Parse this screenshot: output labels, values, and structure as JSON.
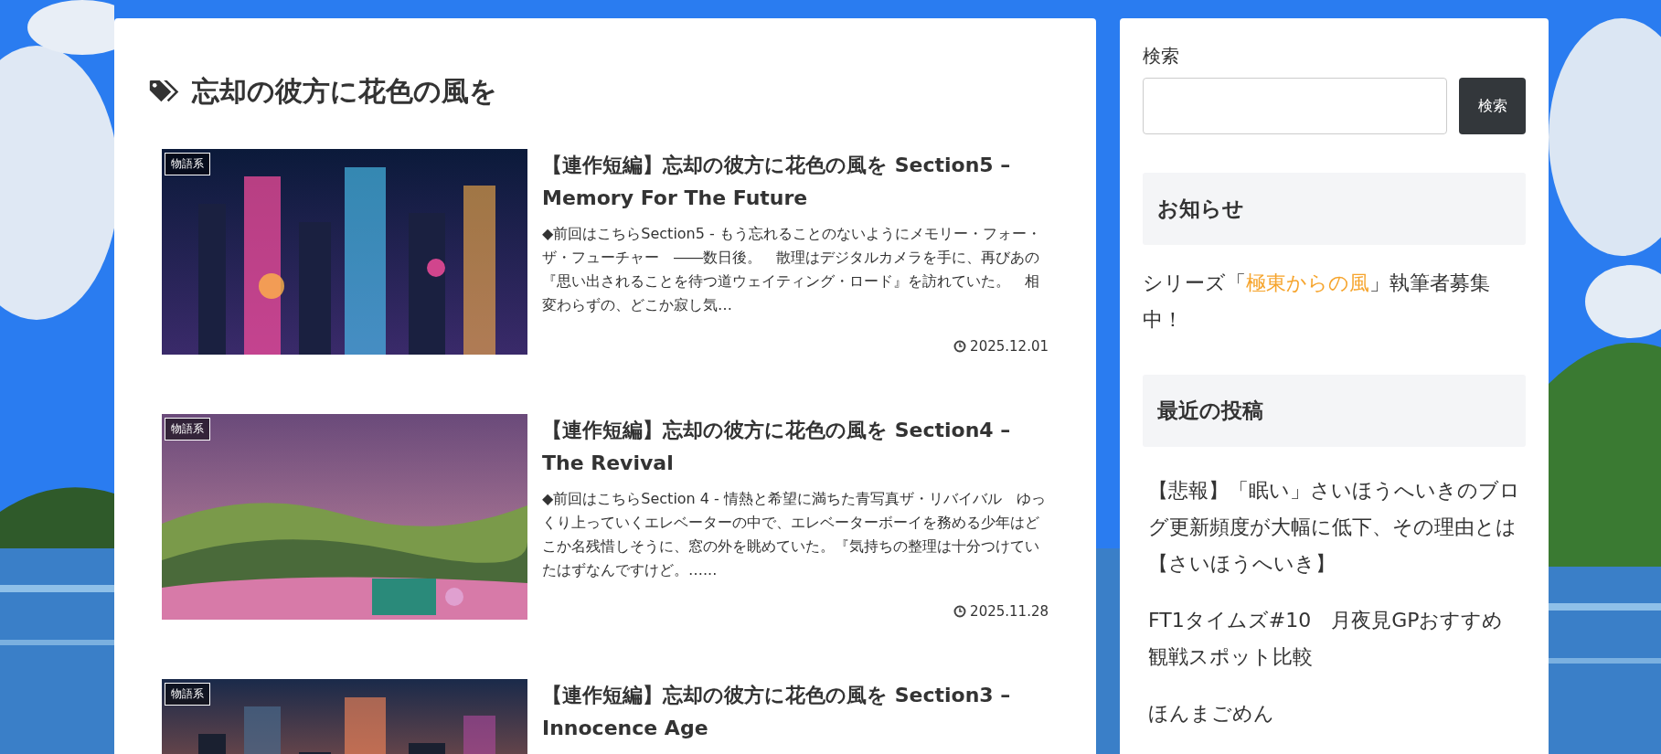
{
  "tag_archive": {
    "title": "忘却の彼方に花色の風を"
  },
  "posts": [
    {
      "category": "物語系",
      "title": "【連作短編】忘却の彼方に花色の風を Section5 – Memory For The Future",
      "excerpt": "◆前回はこちらSection5 - もう忘れることのないようにメモリー・フォー・ザ・フューチャー　――数日後。　散理はデジタルカメラを手に、再びあの『思い出されることを待つ道ウェイティング・ロード』を訪れていた。　相変わらずの、どこか寂し気…",
      "date": "2025.12.01"
    },
    {
      "category": "物語系",
      "title": "【連作短編】忘却の彼方に花色の風を Section4 – The Revival",
      "excerpt": "◆前回はこちらSection 4 - 情熱と希望に満ちた青写真ザ・リバイバル　ゆっくり上っていくエレベーターの中で、エレベーターボーイを務める少年はどこか名残惜しそうに、窓の外を眺めていた。『気持ちの整理は十分つけていたはずなんですけど。…...",
      "date": "2025.11.28"
    },
    {
      "category": "物語系",
      "title": "【連作短編】忘却の彼方に花色の風を Section3 – Innocence Age"
    }
  ],
  "sidebar": {
    "search": {
      "label": "検索",
      "button": "検索"
    },
    "notice": {
      "heading": "お知らせ",
      "text_before": "シリーズ「",
      "link": "極東からの風",
      "text_after": "」執筆者募集中！"
    },
    "recent_posts": {
      "heading": "最近の投稿",
      "items": [
        "【悲報】「眠い」さいほうへいきのブログ更新頻度が大幅に低下、その理由とは【さいほうへいき】",
        "FT1タイムズ#10　月夜見GPおすすめ観戦スポット比較",
        "ほんまごめん"
      ]
    }
  }
}
